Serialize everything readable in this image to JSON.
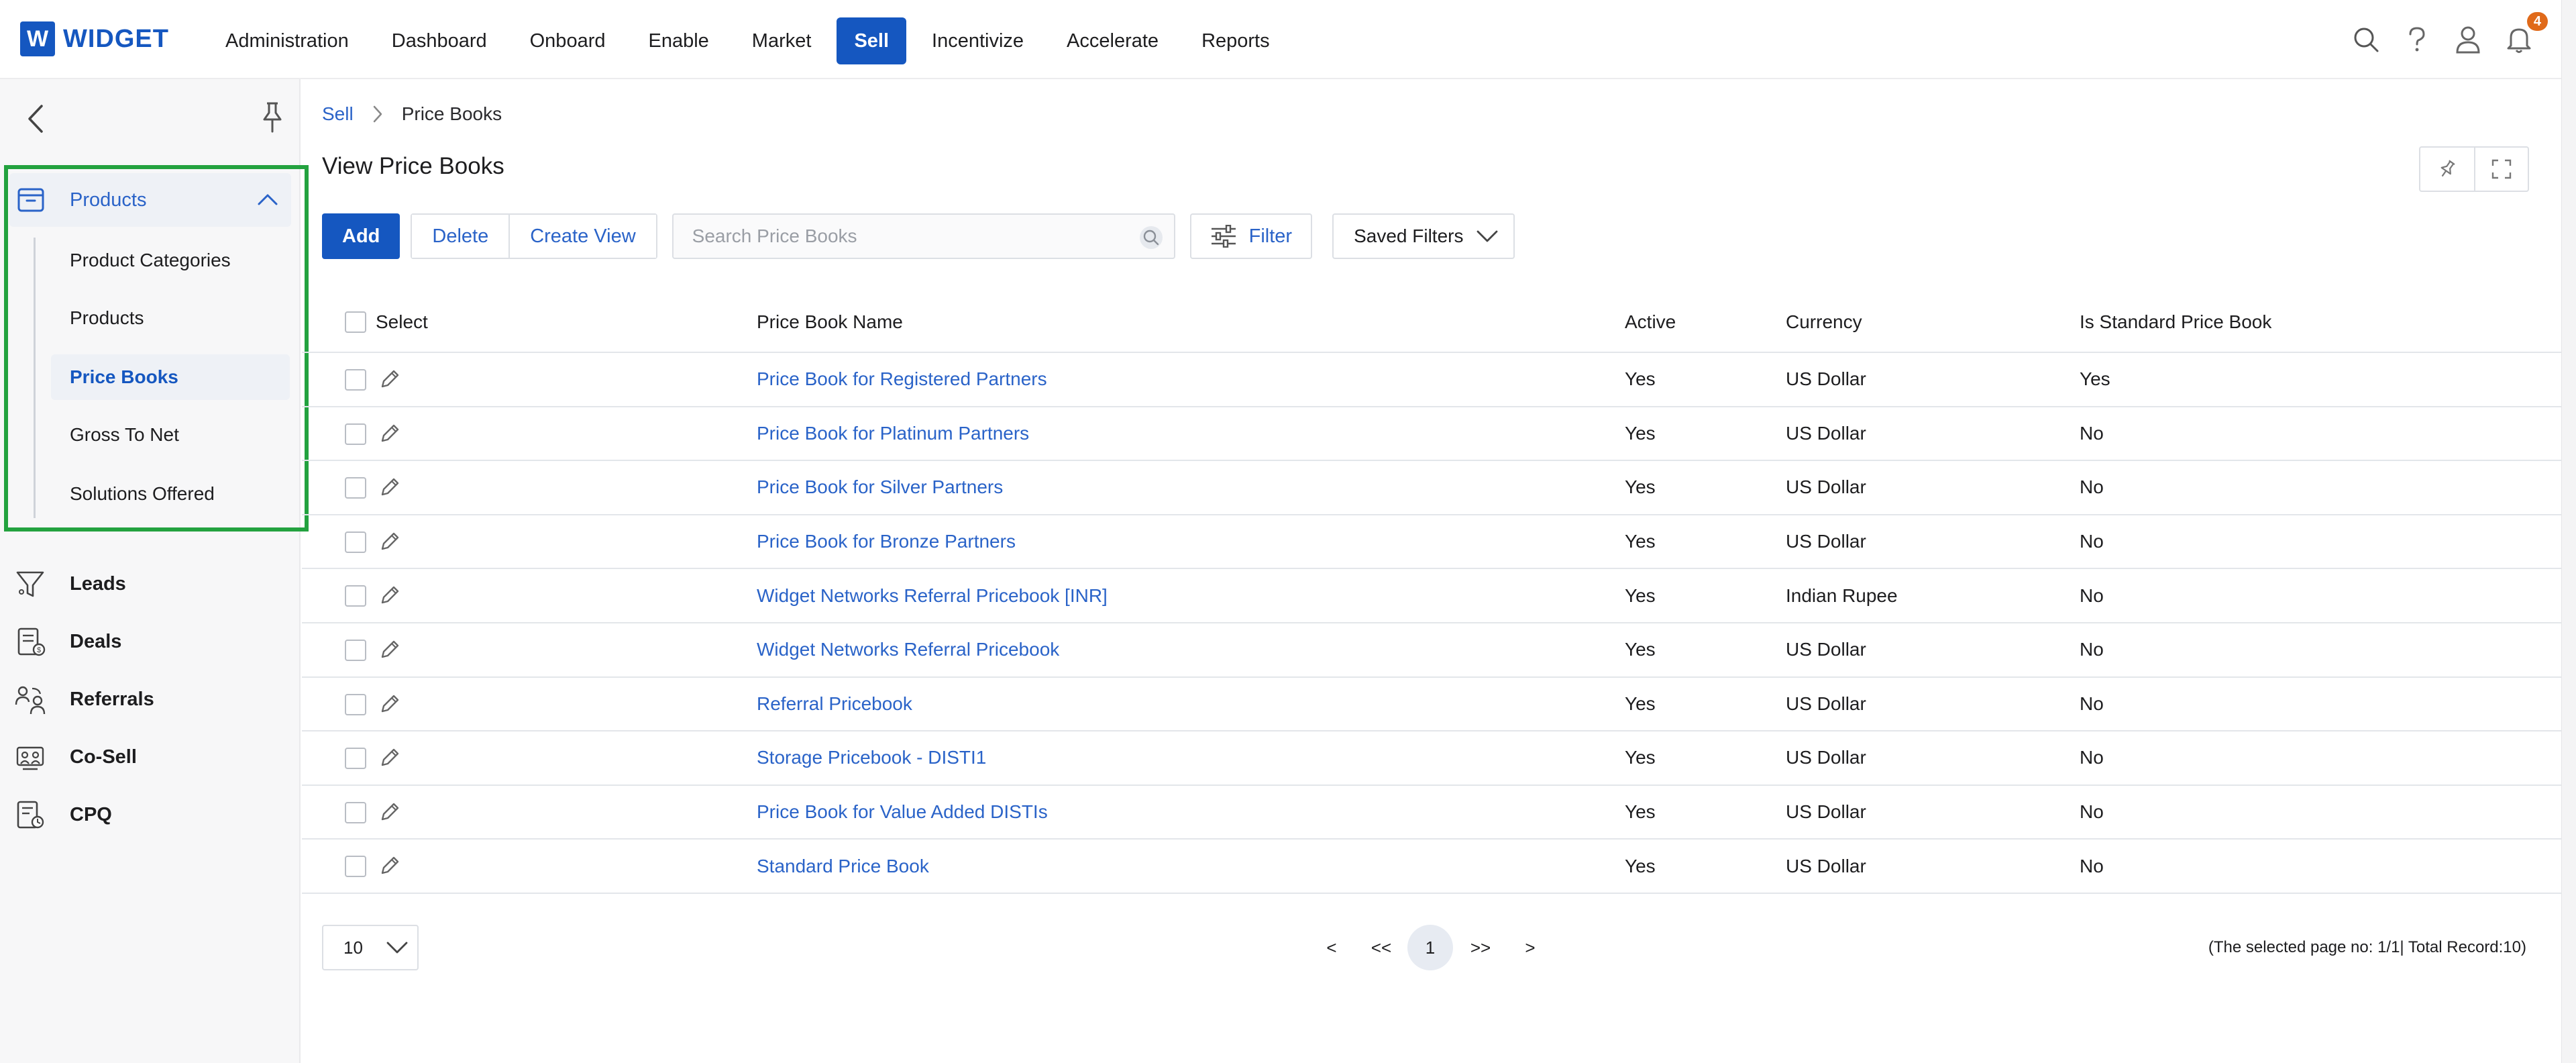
{
  "brand": {
    "logo_letter": "W",
    "name": "WIDGET",
    "accent": "#1557c0"
  },
  "nav": {
    "items": [
      "Administration",
      "Dashboard",
      "Onboard",
      "Enable",
      "Market",
      "Sell",
      "Incentivize",
      "Accelerate",
      "Reports"
    ],
    "active": "Sell"
  },
  "header_icons": {
    "search": "search-icon",
    "help": "help-icon",
    "user": "user-icon",
    "notifications": "bell-icon",
    "notification_count": "4"
  },
  "sidebar": {
    "group": {
      "label": "Products",
      "expanded": true
    },
    "sub_items": [
      "Product Categories",
      "Products",
      "Price Books",
      "Gross To Net",
      "Solutions Offered"
    ],
    "active_sub_item": "Price Books",
    "items": [
      {
        "label": "Leads",
        "icon": "funnel-icon"
      },
      {
        "label": "Deals",
        "icon": "deal-document-icon"
      },
      {
        "label": "Referrals",
        "icon": "referral-people-icon"
      },
      {
        "label": "Co-Sell",
        "icon": "co-sell-icon"
      },
      {
        "label": "CPQ",
        "icon": "cpq-icon"
      }
    ]
  },
  "breadcrumb": {
    "parent": "Sell",
    "current": "Price Books"
  },
  "page": {
    "title": "View Price Books"
  },
  "toolbar": {
    "add_label": "Add",
    "delete_label": "Delete",
    "create_view_label": "Create View",
    "search_placeholder": "Search Price Books",
    "filter_label": "Filter",
    "saved_filters_label": "Saved Filters"
  },
  "table": {
    "columns": {
      "select": "Select",
      "name": "Price Book Name",
      "active": "Active",
      "currency": "Currency",
      "standard": "Is Standard Price Book"
    },
    "rows": [
      {
        "name": "Price Book for Registered Partners",
        "active": "Yes",
        "currency": "US Dollar",
        "standard": "Yes"
      },
      {
        "name": "Price Book for Platinum Partners",
        "active": "Yes",
        "currency": "US Dollar",
        "standard": "No"
      },
      {
        "name": "Price Book for Silver Partners",
        "active": "Yes",
        "currency": "US Dollar",
        "standard": "No"
      },
      {
        "name": "Price Book for Bronze Partners",
        "active": "Yes",
        "currency": "US Dollar",
        "standard": "No"
      },
      {
        "name": "Widget Networks Referral Pricebook [INR]",
        "active": "Yes",
        "currency": "Indian Rupee",
        "standard": "No"
      },
      {
        "name": "Widget Networks Referral Pricebook",
        "active": "Yes",
        "currency": "US Dollar",
        "standard": "No"
      },
      {
        "name": "Referral Pricebook",
        "active": "Yes",
        "currency": "US Dollar",
        "standard": "No"
      },
      {
        "name": "Storage Pricebook - DISTI1",
        "active": "Yes",
        "currency": "US Dollar",
        "standard": "No"
      },
      {
        "name": "Price Book for Value Added DISTIs",
        "active": "Yes",
        "currency": "US Dollar",
        "standard": "No"
      },
      {
        "name": "Standard Price Book",
        "active": "Yes",
        "currency": "US Dollar",
        "standard": "No"
      }
    ]
  },
  "pagination": {
    "page_size": "10",
    "prev": "<",
    "first": "<<",
    "current": "1",
    "last": ">>",
    "next": ">",
    "info": "(The selected page no: 1/1| Total Record:10)"
  }
}
